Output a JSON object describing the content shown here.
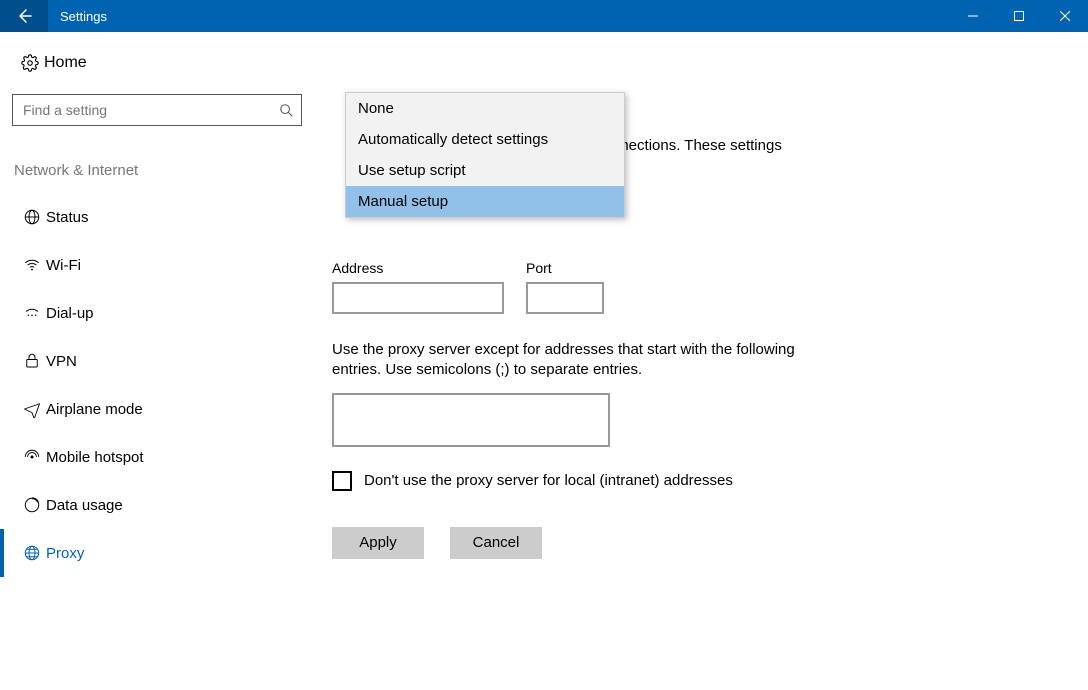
{
  "titlebar": {
    "title": "Settings"
  },
  "sidebar": {
    "home_label": "Home",
    "search_placeholder": "Find a setting",
    "category": "Network & Internet",
    "items": [
      {
        "label": "Status"
      },
      {
        "label": "Wi-Fi"
      },
      {
        "label": "Dial-up"
      },
      {
        "label": "VPN"
      },
      {
        "label": "Airplane mode"
      },
      {
        "label": "Mobile hotspot"
      },
      {
        "label": "Data usage"
      },
      {
        "label": "Proxy"
      }
    ]
  },
  "main": {
    "partial_text": "nnections. These settings",
    "address_label": "Address",
    "port_label": "Port",
    "bypass_text": "Use the proxy server except for addresses that start with the following entries. Use semicolons (;) to separate entries.",
    "checkbox_label": "Don't use the proxy server for local (intranet) addresses",
    "apply_label": "Apply",
    "cancel_label": "Cancel"
  },
  "dropdown": {
    "options": [
      "None",
      "Automatically detect settings",
      "Use setup script",
      "Manual setup"
    ],
    "selected": 3
  }
}
